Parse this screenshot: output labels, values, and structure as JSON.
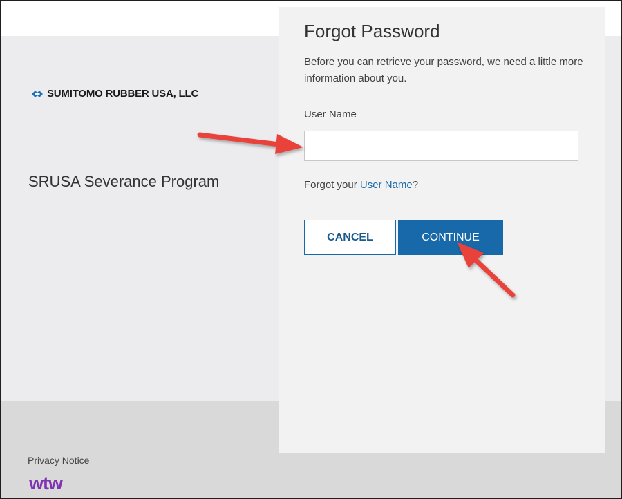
{
  "brand": {
    "company_name": "SUMITOMO RUBBER USA, LLC",
    "program_title": "SRUSA Severance Program",
    "accent_color": "#1769aa",
    "logo_icon": "diamond-logo-icon"
  },
  "forgot_password": {
    "title": "Forgot Password",
    "description": "Before you can retrieve your password, we need a little more information about you.",
    "username_label": "User Name",
    "username_value": "",
    "forgot_prefix": "Forgot your ",
    "forgot_link": "User Name",
    "forgot_suffix": "?",
    "cancel_label": "CANCEL",
    "continue_label": "CONTINUE"
  },
  "footer": {
    "privacy_label": "Privacy Notice",
    "wtw_logo_text": "wtw",
    "wtw_color": "#7f35b2"
  },
  "annotations": {
    "arrow_color": "#e8423a",
    "arrow_icon": "red-arrow-icon"
  }
}
